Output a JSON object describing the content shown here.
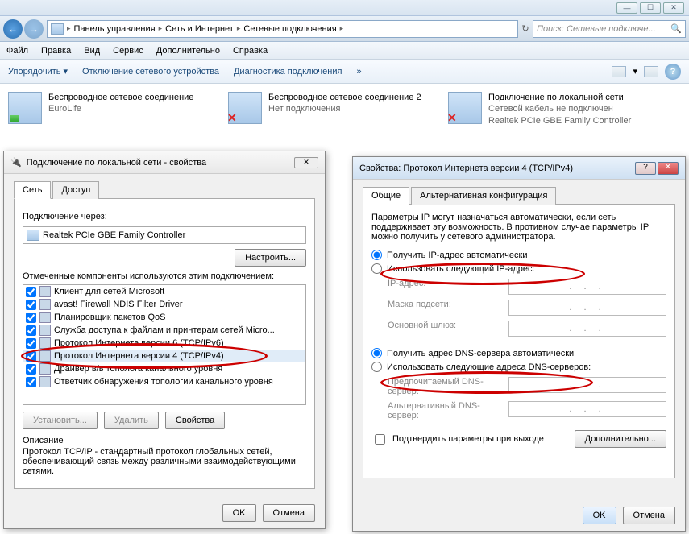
{
  "breadcrumb": [
    "Панель управления",
    "Сеть и Интернет",
    "Сетевые подключения"
  ],
  "search_placeholder": "Поиск: Сетевые подключе...",
  "menus": [
    "Файл",
    "Правка",
    "Вид",
    "Сервис",
    "Дополнительно",
    "Справка"
  ],
  "commandbar": {
    "organize": "Упорядочить",
    "disable": "Отключение сетевого устройства",
    "diag": "Диагностика подключения",
    "chev": "»"
  },
  "connections": [
    {
      "title": "Беспроводное сетевое соединение",
      "sub": "EuroLife"
    },
    {
      "title": "Беспроводное сетевое соединение 2",
      "sub": "Нет подключения"
    },
    {
      "title": "Подключение по локальной сети",
      "sub1": "Сетевой кабель не подключен",
      "sub2": "Realtek PCIe GBE Family Controller"
    }
  ],
  "dlg1": {
    "title": "Подключение по локальной сети - свойства",
    "tabs": [
      "Сеть",
      "Доступ"
    ],
    "connect_via": "Подключение через:",
    "adapter": "Realtek PCIe GBE Family Controller",
    "configure": "Настроить...",
    "components_label": "Отмеченные компоненты используются этим подключением:",
    "components": [
      "Клиент для сетей Microsoft",
      "avast! Firewall NDIS Filter Driver",
      "Планировщик пакетов QoS",
      "Служба доступа к файлам и принтерам сетей Micro...",
      "Протокол Интернета версии 6 (TCP/IPv6)",
      "Протокол Интернета версии 4 (TCP/IPv4)",
      "Драйвер в/в тополога канального уровня",
      "Ответчик обнаружения топологии канального уровня"
    ],
    "install": "Установить...",
    "remove": "Удалить",
    "properties": "Свойства",
    "desc_label": "Описание",
    "desc": "Протокол TCP/IP - стандартный протокол глобальных сетей, обеспечивающий связь между различными взаимодействующими сетями.",
    "ok": "OK",
    "cancel": "Отмена"
  },
  "dlg2": {
    "title": "Свойства: Протокол Интернета версии 4 (TCP/IPv4)",
    "tabs": [
      "Общие",
      "Альтернативная конфигурация"
    ],
    "intro": "Параметры IP могут назначаться автоматически, если сеть поддерживает эту возможность. В противном случае параметры IP можно получить у сетевого администратора.",
    "auto_ip": "Получить IP-адрес автоматически",
    "manual_ip": "Использовать следующий IP-адрес:",
    "ip_label": "IP-адрес:",
    "mask_label": "Маска подсети:",
    "gw_label": "Основной шлюз:",
    "auto_dns": "Получить адрес DNS-сервера автоматически",
    "manual_dns": "Использовать следующие адреса DNS-серверов:",
    "dns1_label": "Предпочитаемый DNS-сервер:",
    "dns2_label": "Альтернативный DNS-сервер:",
    "confirm": "Подтвердить параметры при выходе",
    "advanced": "Дополнительно...",
    "ok": "OK",
    "cancel": "Отмена",
    "dots": ".   .   ."
  }
}
